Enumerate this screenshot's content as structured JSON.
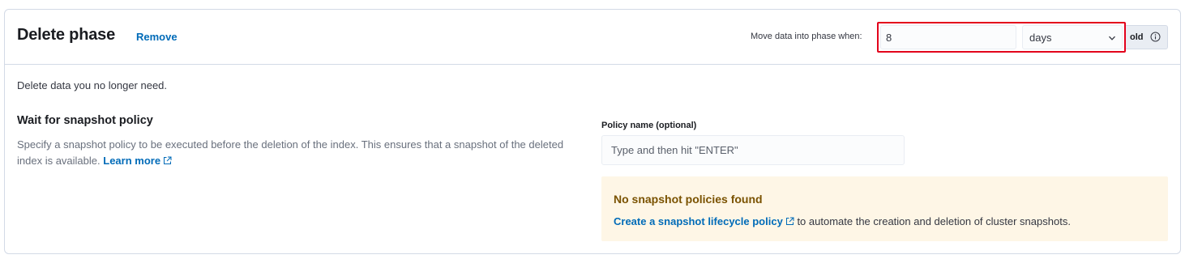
{
  "header": {
    "title": "Delete phase",
    "remove_label": "Remove",
    "move_label": "Move data into phase when:",
    "age_value": "8",
    "unit_value": "days",
    "old_label": "old"
  },
  "body": {
    "description": "Delete data you no longer need.",
    "snapshot_section": {
      "title": "Wait for snapshot policy",
      "text": "Specify a snapshot policy to be executed before the deletion of the index. This ensures that a snapshot of the deleted index is available.",
      "learn_more": "Learn more"
    },
    "policy_field": {
      "label": "Policy name (optional)",
      "placeholder": "Type and then hit \"ENTER\""
    },
    "callout": {
      "title": "No snapshot policies found",
      "link": "Create a snapshot lifecycle policy",
      "text": "to automate the creation and deletion of cluster snapshots."
    }
  },
  "colors": {
    "link": "#006bb8",
    "highlight": "#e3001b",
    "callout_bg": "#fef6e6",
    "callout_title": "#7a5200"
  },
  "icons": [
    "chevron-down-icon",
    "info-icon",
    "external-link-icon"
  ]
}
